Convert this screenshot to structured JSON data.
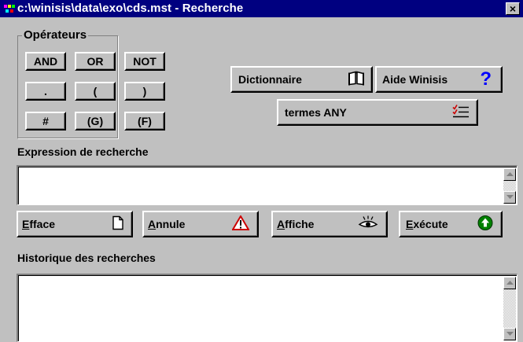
{
  "window": {
    "title": "c:\\winisis\\data\\exo\\cds.mst - Recherche",
    "close_label": "×"
  },
  "operators": {
    "group_label": "Opérateurs",
    "buttons": [
      "AND",
      "OR",
      "NOT",
      ".",
      "(",
      ")",
      "#",
      "(G)",
      "(F)"
    ]
  },
  "actions": {
    "dictionary_label": "Dictionnaire",
    "help_label": "Aide Winisis",
    "any_terms_label": "termes ANY"
  },
  "expression": {
    "label": "Expression de recherche",
    "value": ""
  },
  "commands": {
    "clear": {
      "hotkey": "E",
      "rest": "fface"
    },
    "cancel": {
      "hotkey": "A",
      "rest": "nnule"
    },
    "display": {
      "hotkey": "A",
      "rest": "ffiche"
    },
    "execute": {
      "hotkey": "E",
      "rest": "xécute"
    }
  },
  "history": {
    "label": "Historique des recherches",
    "value": ""
  },
  "icons": {
    "dictionary": "open-book-icon",
    "help": "question-mark-icon",
    "any_terms": "checklist-icon",
    "clear": "page-icon",
    "cancel": "warning-icon",
    "display": "eye-icon",
    "execute": "green-arrow-up-icon"
  },
  "colors": {
    "titlebar": "#000080",
    "help_icon": "#0000ff",
    "warning_icon": "#cc0000",
    "execute_icon": "#008000"
  }
}
